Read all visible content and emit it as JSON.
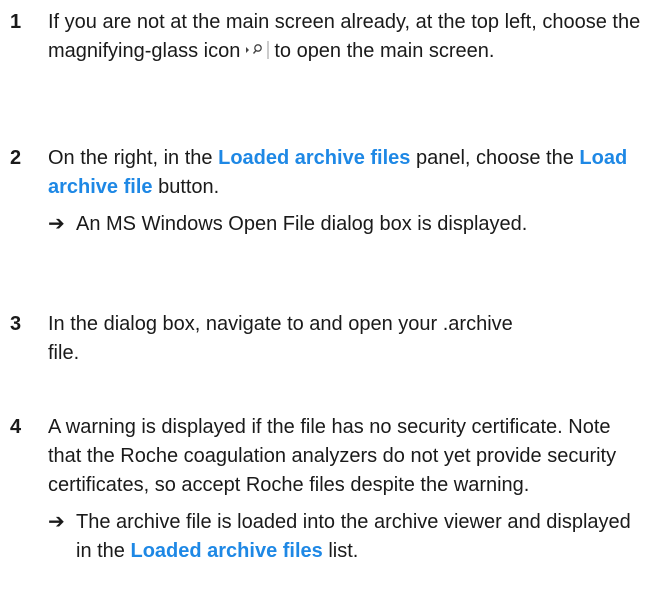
{
  "steps": [
    {
      "number": "1",
      "text_before": "If you are not at the main screen already, at the top left, choose the magnifying-glass icon",
      "icon": "magnifying-glass-icon",
      "text_after": "to open the main screen."
    },
    {
      "number": "2",
      "text_1": "On the right, in the ",
      "highlight_1": "Loaded archive files",
      "text_2": " panel, choose the ",
      "highlight_2": "Load archive file",
      "text_3": " button.",
      "result_arrow": "➔",
      "result_text": "An MS Windows Open File dialog box is displayed."
    },
    {
      "number": "3",
      "text": "In the dialog box, navigate to and open your .archive file."
    },
    {
      "number": "4",
      "text": "A warning is displayed if the file has no security certificate. Note that the Roche coagulation analyzers do not yet provide security certificates, so accept Roche files despite the warning.",
      "result_arrow": "➔",
      "result_text_1": "The archive file is loaded into the archive viewer and displayed in the ",
      "result_highlight": "Loaded archive files",
      "result_text_2": " list."
    }
  ],
  "colors": {
    "highlight": "#1e88e5",
    "text": "#1a1a1a"
  }
}
